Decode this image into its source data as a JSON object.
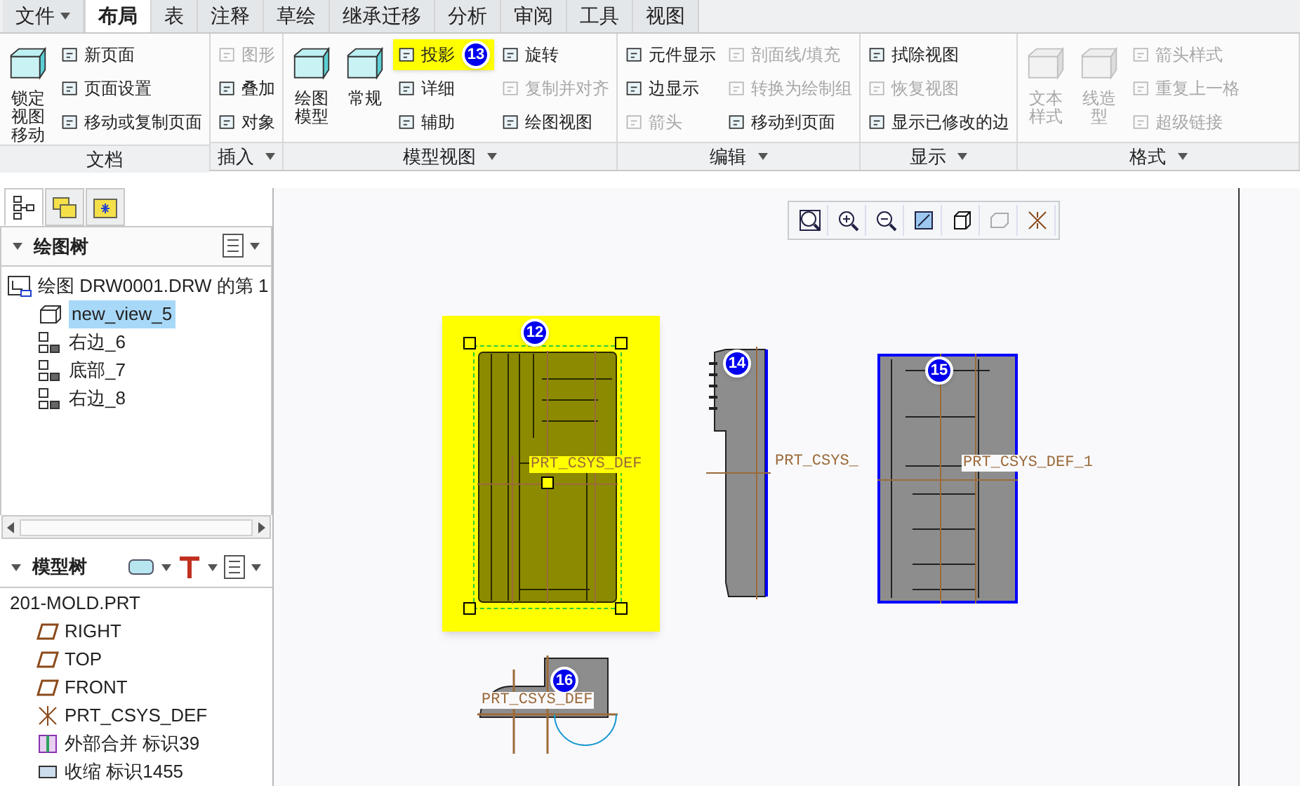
{
  "tabs": [
    {
      "label": "文件",
      "menu": true,
      "selected": false
    },
    {
      "label": "布局",
      "menu": false,
      "selected": true
    },
    {
      "label": "表",
      "menu": false,
      "selected": false
    },
    {
      "label": "注释",
      "menu": false,
      "selected": false
    },
    {
      "label": "草绘",
      "menu": false,
      "selected": false
    },
    {
      "label": "继承迁移",
      "menu": false,
      "selected": false
    },
    {
      "label": "分析",
      "menu": false,
      "selected": false
    },
    {
      "label": "审阅",
      "menu": false,
      "selected": false
    },
    {
      "label": "工具",
      "menu": false,
      "selected": false
    },
    {
      "label": "视图",
      "menu": false,
      "selected": false
    }
  ],
  "ribbon": [
    {
      "label": "文档",
      "menu": false,
      "large": [
        {
          "label": "锁定视图移动",
          "disabled": false
        }
      ],
      "columns": [
        [
          {
            "label": "新页面",
            "disabled": false
          },
          {
            "label": "页面设置",
            "disabled": false
          },
          {
            "label": "移动或复制页面",
            "disabled": false
          }
        ]
      ]
    },
    {
      "label": "插入",
      "menu": true,
      "columns": [
        [
          {
            "label": "图形",
            "disabled": true
          },
          {
            "label": "叠加",
            "disabled": false
          },
          {
            "label": "对象",
            "disabled": false
          }
        ]
      ]
    },
    {
      "label": "模型视图",
      "menu": true,
      "large": [
        {
          "label": "绘图模型",
          "disabled": false
        },
        {
          "label": "常规",
          "disabled": false
        }
      ],
      "columns": [
        [
          {
            "label": "投影",
            "disabled": false,
            "highlighted": true,
            "badge": "13"
          },
          {
            "label": "详细",
            "disabled": false
          },
          {
            "label": "辅助",
            "disabled": false
          }
        ],
        [
          {
            "label": "旋转",
            "disabled": false
          },
          {
            "label": "复制并对齐",
            "disabled": true
          },
          {
            "label": "绘图视图",
            "disabled": false
          }
        ]
      ]
    },
    {
      "label": "编辑",
      "menu": true,
      "columns": [
        [
          {
            "label": "元件显示",
            "disabled": false
          },
          {
            "label": "边显示",
            "disabled": false
          },
          {
            "label": "箭头",
            "disabled": true
          }
        ],
        [
          {
            "label": "剖面线/填充",
            "disabled": true
          },
          {
            "label": "转换为绘制组",
            "disabled": true
          },
          {
            "label": "移动到页面",
            "disabled": false
          }
        ]
      ]
    },
    {
      "label": "显示",
      "menu": true,
      "columns": [
        [
          {
            "label": "拭除视图",
            "disabled": false
          },
          {
            "label": "恢复视图",
            "disabled": true
          },
          {
            "label": "显示已修改的边",
            "disabled": false
          }
        ]
      ]
    },
    {
      "label": "格式",
      "menu": true,
      "large": [
        {
          "label": "文本样式",
          "disabled": true
        },
        {
          "label": "线造型",
          "disabled": true
        }
      ],
      "columns": [
        [
          {
            "label": "箭头样式",
            "disabled": true
          },
          {
            "label": "重复上一格",
            "disabled": true
          },
          {
            "label": "超级链接",
            "disabled": true
          }
        ]
      ]
    }
  ],
  "panel_tabs": [
    {
      "selected": true
    },
    {
      "selected": false
    },
    {
      "selected": false
    }
  ],
  "drawing_tree": {
    "title": "绘图树",
    "root": {
      "label": "绘图 DRW0001.DRW 的第 1",
      "children": [
        {
          "label": "new_view_5",
          "selected": true,
          "kind": "general"
        },
        {
          "label": "右边_6",
          "selected": false,
          "kind": "projection"
        },
        {
          "label": "底部_7",
          "selected": false,
          "kind": "projection"
        },
        {
          "label": "右边_8",
          "selected": false,
          "kind": "projection"
        }
      ]
    }
  },
  "model_tree": {
    "title": "模型树",
    "root": {
      "label": "201-MOLD.PRT",
      "children": [
        {
          "label": "RIGHT",
          "kind": "plane"
        },
        {
          "label": "TOP",
          "kind": "plane"
        },
        {
          "label": "FRONT",
          "kind": "plane"
        },
        {
          "label": "PRT_CSYS_DEF",
          "kind": "csys"
        },
        {
          "label": "外部合并 标识39",
          "kind": "merge"
        },
        {
          "label": "收缩 标识1455",
          "kind": "shrink"
        }
      ]
    }
  },
  "views": [
    {
      "badge": "12",
      "label": "PRT_CSYS_DEF",
      "kind": "front",
      "selected": true
    },
    {
      "badge": "14",
      "label": "PRT_CSYS_",
      "kind": "side",
      "selected": false
    },
    {
      "badge": "15",
      "label": "PRT_CSYS_DEF_1",
      "kind": "back",
      "selected": false
    },
    {
      "badge": "16",
      "label": "PRT_CSYS_DEF",
      "kind": "bottom",
      "selected": false
    }
  ]
}
